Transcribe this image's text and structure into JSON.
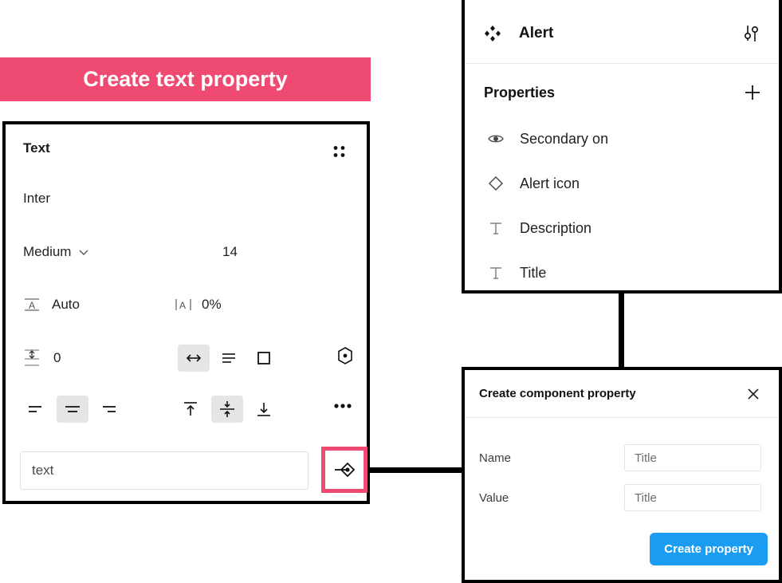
{
  "banner": {
    "label": "Create text property",
    "background": "#ee4a72",
    "text_color": "#ffffff"
  },
  "text_panel": {
    "title": "Text",
    "grip_icon": "drag-grip-icon",
    "font_family": "Inter",
    "font_weight": "Medium",
    "font_size": "14",
    "line_height": "Auto",
    "letter_spacing": "0%",
    "paragraph_spacing": "0",
    "input_value": "text",
    "apply_icon": "apply-property-icon",
    "apply_highlight_color": "#ee4a72",
    "align_horizontal": [
      "align-left-icon",
      "align-center-icon",
      "align-right-icon"
    ],
    "align_horizontal_active": 1,
    "align_vertical": [
      "align-top-icon",
      "align-middle-icon",
      "align-bottom-icon"
    ],
    "align_vertical_active": 1,
    "resize_icons": [
      "auto-width-icon",
      "auto-height-icon",
      "fixed-size-icon"
    ],
    "resize_active": 0,
    "type_settings_icon": "type-settings-icon",
    "more_icon": "more-options-icon"
  },
  "alert_panel": {
    "component_icon": "component-diamond-icon",
    "title": "Alert",
    "settings_icon": "sliders-icon",
    "properties_label": "Properties",
    "add_icon": "plus-icon",
    "properties": [
      {
        "icon": "eye-icon",
        "label": "Secondary on"
      },
      {
        "icon": "diamond-icon",
        "label": "Alert icon"
      },
      {
        "icon": "text-type-icon",
        "label": "Description"
      },
      {
        "icon": "text-type-icon",
        "label": "Title"
      }
    ]
  },
  "dialog": {
    "title": "Create component property",
    "close_icon": "close-icon",
    "name_label": "Name",
    "name_value": "Title",
    "value_label": "Value",
    "value_value": "Title",
    "submit_label": "Create property",
    "submit_color": "#1a9cf2"
  }
}
